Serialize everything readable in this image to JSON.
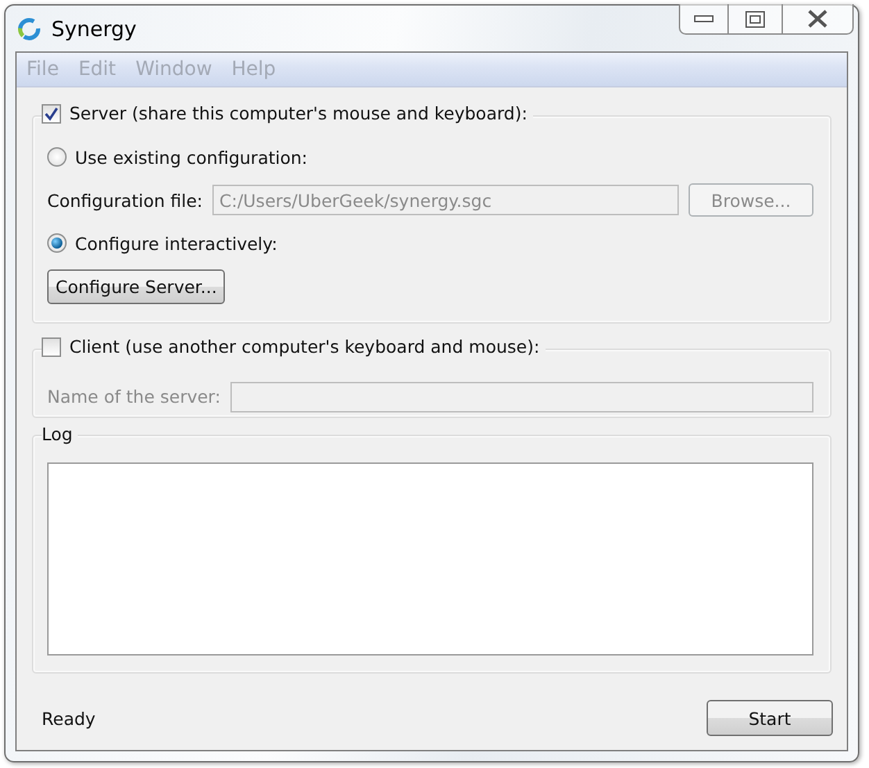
{
  "window": {
    "title": "Synergy"
  },
  "menu": [
    {
      "label": "File",
      "disabled": true
    },
    {
      "label": "Edit",
      "disabled": true
    },
    {
      "label": "Window",
      "disabled": true
    },
    {
      "label": "Help",
      "disabled": true
    }
  ],
  "server": {
    "label": "Server (share this computer's mouse and keyboard):",
    "checked": true,
    "options": [
      {
        "label": "Use existing configuration:",
        "selected": false
      },
      {
        "label": "Configure interactively:",
        "selected": true
      }
    ],
    "config_file": {
      "label": "Configuration file:",
      "value": "C:/Users/UberGeek/synergy.sgc",
      "disabled": true
    },
    "browse_button": {
      "label": "Browse...",
      "disabled": true
    },
    "configure_button": {
      "label": "Configure Server...",
      "disabled": false
    }
  },
  "client": {
    "label": "Client (use another computer's keyboard and mouse):",
    "checked": false,
    "server_name": {
      "label": "Name of the server:",
      "disabled": true
    }
  },
  "log": {
    "title": "Log"
  },
  "status": "Ready",
  "start_button": "Start"
}
